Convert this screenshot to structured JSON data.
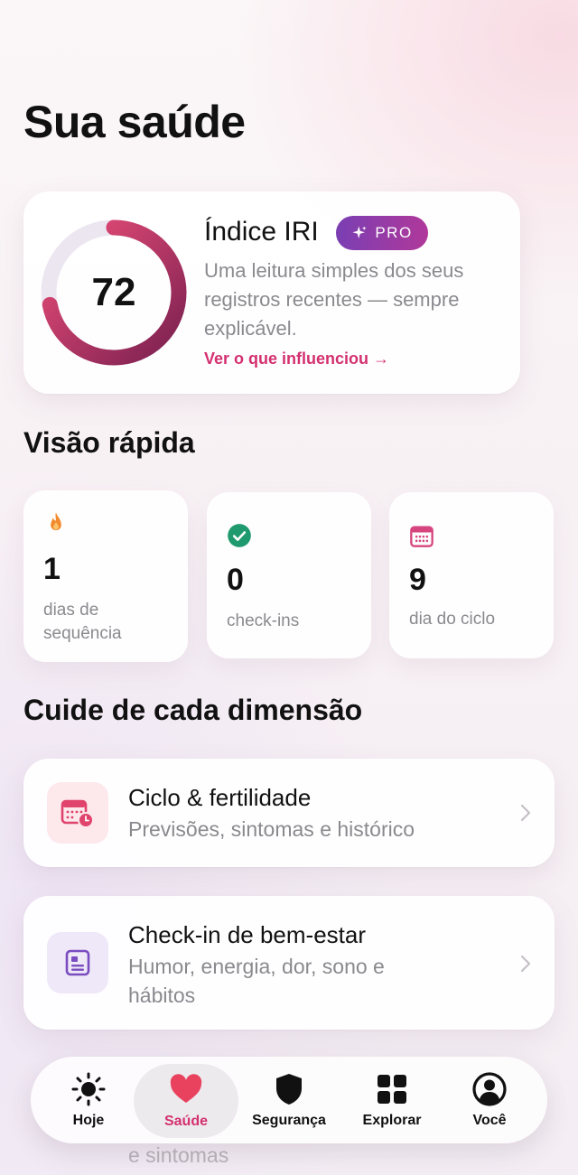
{
  "page": {
    "title": "Sua saúde"
  },
  "iri": {
    "score": "72",
    "score_fraction": 0.72,
    "title": "Índice IRI",
    "badge": "PRO",
    "description": "Uma leitura simples dos seus registros recentes — sempre explicável.",
    "link": "Ver o que influenciou →"
  },
  "quick": {
    "title": "Visão rápida",
    "stats": [
      {
        "value": "1",
        "label": "dias de sequência",
        "icon": "flame-icon"
      },
      {
        "value": "0",
        "label": "check-ins",
        "icon": "check-circle-icon"
      },
      {
        "value": "9",
        "label": "dia do ciclo",
        "icon": "calendar-icon"
      }
    ]
  },
  "dimensions": {
    "title": "Cuide de cada dimensão",
    "items": [
      {
        "title": "Ciclo & fertilidade",
        "subtitle": "Previsões, sintomas e histórico",
        "icon": "calendar-clock-icon"
      },
      {
        "title": "Check-in de bem-estar",
        "subtitle": "Humor, energia, dor, sono e hábitos",
        "icon": "journal-icon"
      }
    ],
    "partial_text": "e sintomas"
  },
  "tabbar": {
    "tabs": [
      {
        "label": "Hoje",
        "icon": "sun-icon"
      },
      {
        "label": "Saúde",
        "icon": "heart-icon",
        "active": true
      },
      {
        "label": "Segurança",
        "icon": "shield-icon"
      },
      {
        "label": "Explorar",
        "icon": "grid-icon"
      },
      {
        "label": "Você",
        "icon": "person-circle-icon"
      }
    ]
  },
  "colors": {
    "accent": "#d3306f",
    "ring_start": "#ee4f7a",
    "ring_end": "#7a2050",
    "pro_start": "#7a3fb3",
    "pro_end": "#b0389a",
    "streak": "#f28a2e",
    "check": "#1f9a6f",
    "calendar": "#d6457e",
    "journal": "#7a4cc0"
  }
}
